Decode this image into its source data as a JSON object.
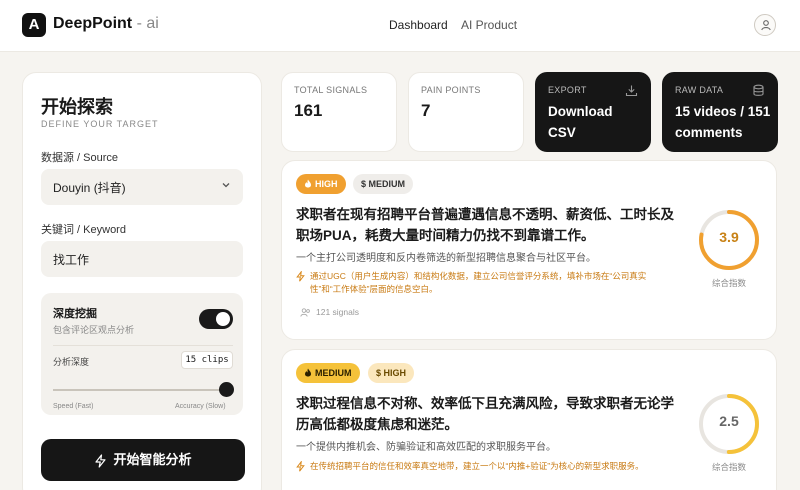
{
  "header": {
    "logo_letter": "A",
    "brand": "DeepPoint",
    "brand_suffix": " - ai",
    "nav": [
      "Dashboard",
      "AI Product"
    ],
    "user_icon": "user-icon"
  },
  "sidebar": {
    "title": "开始探索",
    "subtitle": "DEFINE YOUR TARGET",
    "source_label": "数据源 / Source",
    "source_value": "Douyin (抖音)",
    "keyword_label": "关键词 / Keyword",
    "keyword_value": "找工作",
    "deep": {
      "title": "深度挖掘",
      "subtitle": "包含评论区观点分析",
      "enabled": true,
      "depth_label": "分析深度",
      "depth_value": "15 clips",
      "slider_fraction": 1.0,
      "min_label": "Speed (Fast)",
      "max_label": "Accuracy (Slow)"
    },
    "cta_label": "开始智能分析"
  },
  "stats": [
    {
      "caption": "TOTAL SIGNALS",
      "value": "161"
    },
    {
      "caption": "PAIN POINTS",
      "value": "7"
    },
    {
      "caption": "EXPORT",
      "value": "Download CSV",
      "icon": "download-icon"
    },
    {
      "caption": "RAW DATA",
      "value": "15 videos / 151 comments",
      "icon": "database-icon"
    }
  ],
  "cards": [
    {
      "tags": [
        "HIGH",
        "$ MEDIUM"
      ],
      "title": "求职者在现有招聘平台普遍遭遇信息不透明、薪资低、工时长及职场PUA，耗费大量时间精力仍找不到靠谱工作。",
      "description": "一个主打公司透明度和反内卷筛选的新型招聘信息聚合与社区平台。",
      "insight": "通过UGC（用户生成内容）和结构化数据，建立公司信誉评分系统，填补市场在“公司真实性”和“工作体验”层面的信息空白。",
      "signals": "121 signals",
      "score": 3.9,
      "score_label": "综合指数",
      "accent": "#f0a030"
    },
    {
      "tags": [
        "MEDIUM",
        "$ HIGH"
      ],
      "title": "求职过程信息不对称、效率低下且充满风险，导致求职者无论学历高低都极度焦虑和迷茫。",
      "description": "一个提供内推机会、防骗验证和高效匹配的求职服务平台。",
      "insight": "在传统招聘平台的信任和效率真空地带，建立一个以“内推+验证”为核心的新型求职服务。",
      "score": 2.5,
      "score_label": "综合指数",
      "accent": "#f5c23a"
    }
  ]
}
